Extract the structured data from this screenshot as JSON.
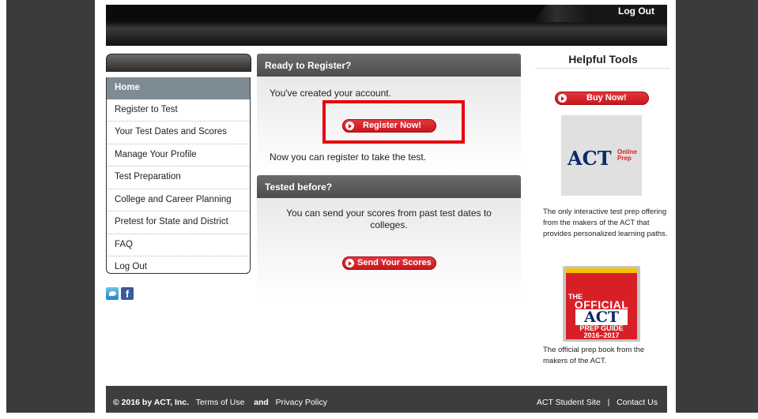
{
  "header": {
    "logout_label": "Log Out"
  },
  "nav": {
    "items": [
      {
        "label": "Home",
        "active": true
      },
      {
        "label": "Register to Test"
      },
      {
        "label": "Your Test Dates and Scores"
      },
      {
        "label": "Manage Your Profile"
      },
      {
        "label": "Test Preparation"
      },
      {
        "label": "College and Career Planning"
      },
      {
        "label": "Pretest for State and District"
      },
      {
        "label": "FAQ"
      },
      {
        "label": "Log Out"
      }
    ]
  },
  "social": {
    "twitter_icon": "twitter-icon",
    "facebook_icon": "facebook-icon",
    "facebook_glyph": "f"
  },
  "register_panel": {
    "title": "Ready to Register?",
    "created_text": "You've created your account.",
    "button_label": "Register Now!",
    "followup_text": "Now you can register to take the test."
  },
  "tested_panel": {
    "title": "Tested before?",
    "text": "You can send your scores from past test dates to colleges.",
    "button_label": "Send Your Scores"
  },
  "tools": {
    "title": "Helpful Tools",
    "buy_label": "Buy Now!",
    "online_prep_brand": "ACT",
    "online_prep_line1": "Online",
    "online_prep_line2": "Prep",
    "online_prep_text": "The only interactive test prep offering from the makers of the ACT that provides personalized learning paths.",
    "book_cover": {
      "the": "THE",
      "official": "OFFICIAL",
      "act": "ACT",
      "guide": "PREP GUIDE",
      "years": "2016–2017"
    },
    "book_text": "The official prep book from the makers of the ACT."
  },
  "footer": {
    "copyright": "© 2016 by ACT, Inc.",
    "terms": "Terms of Use",
    "and": "and",
    "privacy": "Privacy Policy",
    "student_site": "ACT Student Site",
    "separator": "|",
    "contact": "Contact Us"
  },
  "colors": {
    "accent_red": "#c8141b",
    "nav_active": "#7d8b95",
    "panel_header": "#5a5a5a"
  }
}
